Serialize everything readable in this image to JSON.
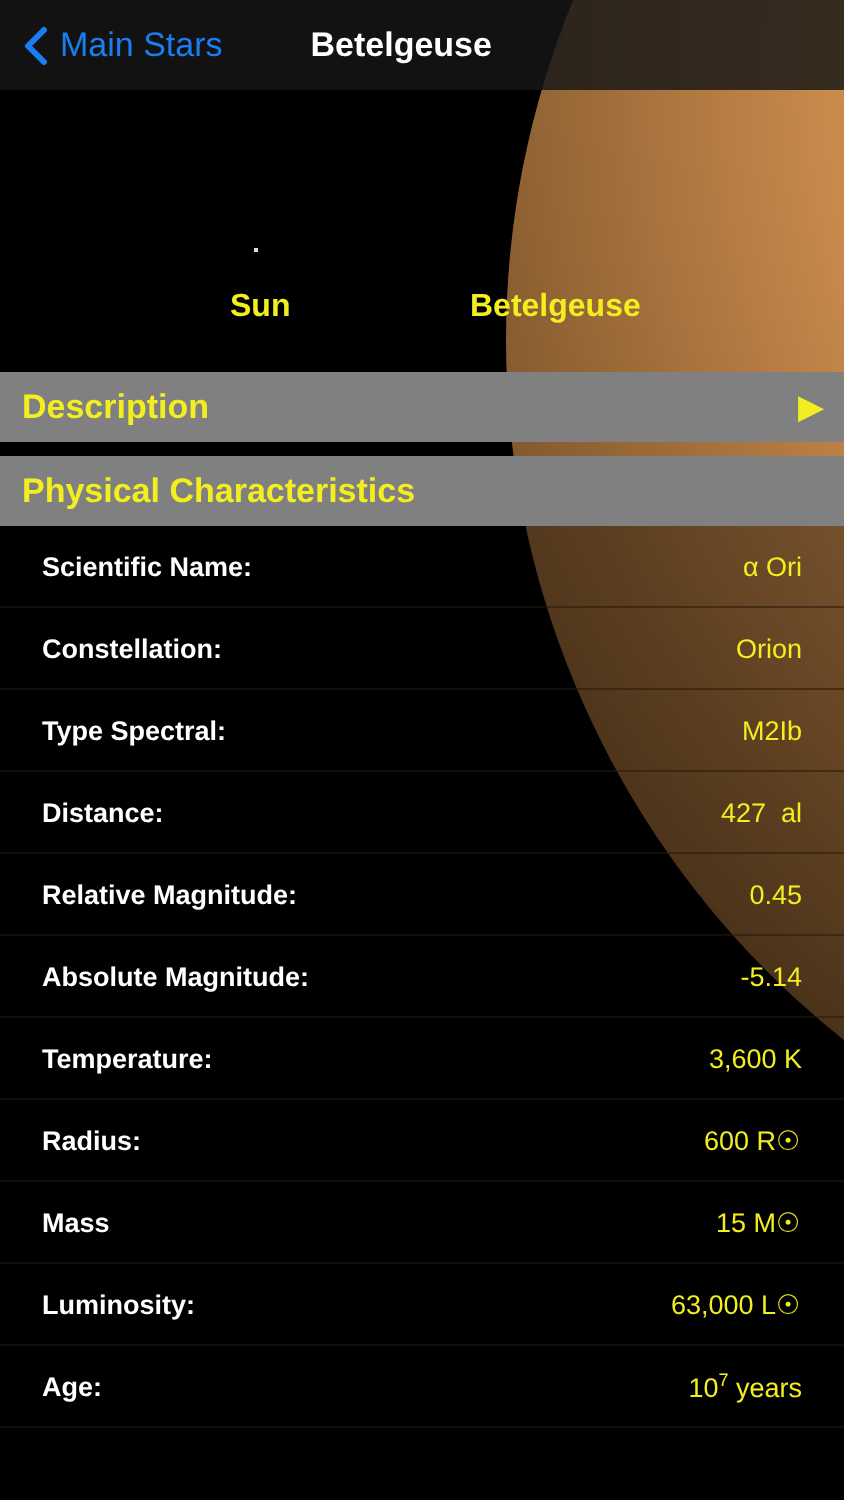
{
  "nav": {
    "back_label": "Main Stars",
    "title": "Betelgeuse"
  },
  "comparison": {
    "labels": [
      "Sun",
      "Betelgeuse"
    ]
  },
  "sections": [
    {
      "title": "Description",
      "arrow": "▶"
    },
    {
      "title": "Physical Characteristics"
    }
  ],
  "rows": [
    {
      "label": "Scientific Name:",
      "value": "α Ori"
    },
    {
      "label": "Constellation:",
      "value": "Orion"
    },
    {
      "label": "Type Spectral:",
      "value": "M2Ib"
    },
    {
      "label": "Distance:",
      "value": "427  al"
    },
    {
      "label": "Relative Magnitude:",
      "value": "0.45"
    },
    {
      "label": "Absolute Magnitude:",
      "value": "-5.14"
    },
    {
      "label": "Temperature:",
      "value": "3,600 K"
    },
    {
      "label": "Radius:",
      "value": "600 R☉"
    },
    {
      "label": "Mass",
      "value": "15 M☉"
    },
    {
      "label": "Luminosity:",
      "value": "63,000 L☉"
    },
    {
      "label": "Age:",
      "value": "10$^{7}$ years"
    }
  ]
}
